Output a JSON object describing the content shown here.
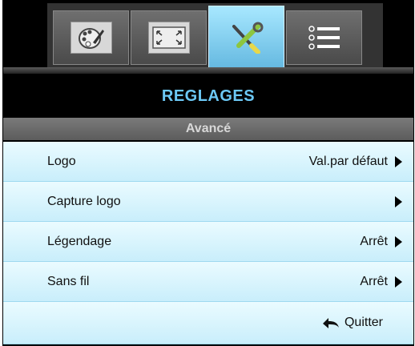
{
  "tabs": [
    {
      "icon": "palette-icon",
      "active": false
    },
    {
      "icon": "fullscreen-icon",
      "active": false
    },
    {
      "icon": "tools-icon",
      "active": true
    },
    {
      "icon": "list-icon",
      "active": false
    }
  ],
  "title": "REGLAGES",
  "subtitle": "Avancé",
  "items": [
    {
      "label": "Logo",
      "value": "Val.par défaut"
    },
    {
      "label": "Capture logo",
      "value": ""
    },
    {
      "label": "Légendage",
      "value": "Arrêt"
    },
    {
      "label": "Sans fil",
      "value": "Arrêt"
    }
  ],
  "footer": {
    "quit_label": "Quitter"
  },
  "colors": {
    "accent": "#6cc8f5",
    "row_bg": "#d9f4fd"
  }
}
